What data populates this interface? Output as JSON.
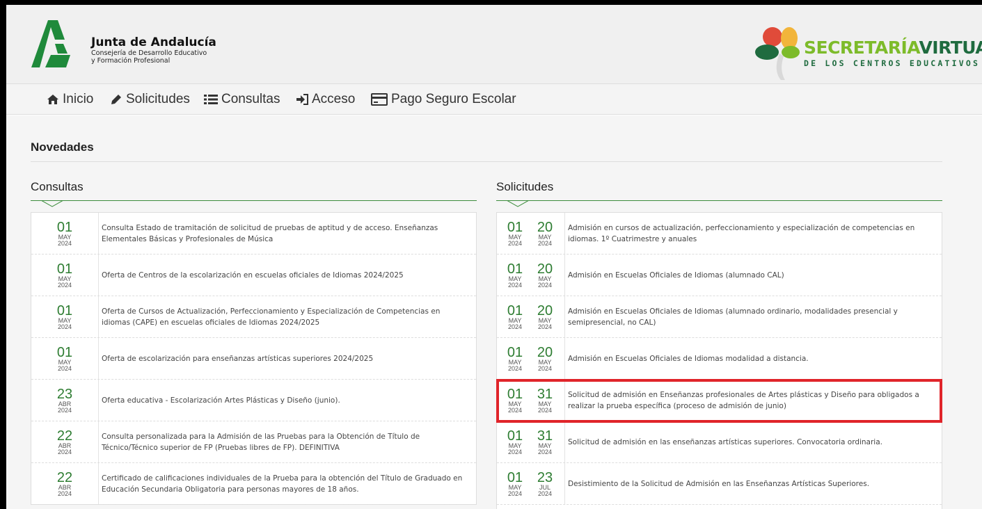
{
  "header": {
    "org_title": "Junta de Andalucía",
    "org_sub1": "Consejería de Desarrollo Educativo",
    "org_sub2": "y Formación Profesional",
    "sv_title_a": "SECRETARÍA",
    "sv_title_b": "VIRTUAL",
    "sv_sub": "DE LOS CENTROS EDUCATIVOS"
  },
  "nav": [
    {
      "label": "Inicio",
      "icon": "home-icon"
    },
    {
      "label": "Solicitudes",
      "icon": "pencil-icon"
    },
    {
      "label": "Consultas",
      "icon": "list-icon"
    },
    {
      "label": "Acceso",
      "icon": "sign-in-icon"
    },
    {
      "label": "Pago Seguro Escolar",
      "icon": "credit-card-icon"
    }
  ],
  "novedades_title": "Novedades",
  "consultas": {
    "title": "Consultas",
    "rows": [
      {
        "day": "01",
        "mon": "MAY",
        "yr": "2024",
        "text": "Consulta Estado de tramitación de solicitud de pruebas de aptitud y de acceso. Enseñanzas Elementales Básicas y Profesionales de Música"
      },
      {
        "day": "01",
        "mon": "MAY",
        "yr": "2024",
        "text": "Oferta de Centros de la escolarización en escuelas oficiales de Idiomas 2024/2025"
      },
      {
        "day": "01",
        "mon": "MAY",
        "yr": "2024",
        "text": "Oferta de Cursos de Actualización, Perfeccionamiento y Especialización de Competencias en idiomas (CAPE) en escuelas oficiales de Idiomas 2024/2025"
      },
      {
        "day": "01",
        "mon": "MAY",
        "yr": "2024",
        "text": "Oferta de escolarización para enseñanzas artísticas superiores 2024/2025"
      },
      {
        "day": "23",
        "mon": "ABR",
        "yr": "2024",
        "text": "Oferta educativa - Escolarización Artes Plásticas y Diseño (junio)."
      },
      {
        "day": "22",
        "mon": "ABR",
        "yr": "2024",
        "text": "Consulta personalizada para la Admisión de las Pruebas para la Obtención de Título de Técnico/Técnico superior de FP (Pruebas libres de FP). DEFINITIVA"
      },
      {
        "day": "22",
        "mon": "ABR",
        "yr": "2024",
        "text": "Certificado de calificaciones individuales de la Prueba para la obtención del Título de Graduado en Educación Secundaria Obligatoria para personas mayores de 18 años."
      }
    ]
  },
  "solicitudes": {
    "title": "Solicitudes",
    "rows": [
      {
        "d1": "01",
        "m1": "MAY",
        "y1": "2024",
        "d2": "20",
        "m2": "MAY",
        "y2": "2024",
        "text": "Admisión en cursos de actualización, perfeccionamiento y especialización de competencias en idiomas. 1º Cuatrimestre y anuales"
      },
      {
        "d1": "01",
        "m1": "MAY",
        "y1": "2024",
        "d2": "20",
        "m2": "MAY",
        "y2": "2024",
        "text": "Admisión en Escuelas Oficiales de Idiomas (alumnado CAL)"
      },
      {
        "d1": "01",
        "m1": "MAY",
        "y1": "2024",
        "d2": "20",
        "m2": "MAY",
        "y2": "2024",
        "text": "Admisión en Escuelas Oficiales de Idiomas (alumnado ordinario, modalidades presencial y semipresencial, no CAL)"
      },
      {
        "d1": "01",
        "m1": "MAY",
        "y1": "2024",
        "d2": "20",
        "m2": "MAY",
        "y2": "2024",
        "text": "Admisión en Escuelas Oficiales de Idiomas modalidad a distancia."
      },
      {
        "d1": "01",
        "m1": "MAY",
        "y1": "2024",
        "d2": "31",
        "m2": "MAY",
        "y2": "2024",
        "text": "Solicitud de admisión en Enseñanzas profesionales de Artes plásticas y Diseño para obligados a realizar la prueba específica (proceso de admisión de junio)"
      },
      {
        "d1": "01",
        "m1": "MAY",
        "y1": "2024",
        "d2": "31",
        "m2": "MAY",
        "y2": "2024",
        "text": "Solicitud de admisión en las enseñanzas artísticas superiores. Convocatoria ordinaria."
      },
      {
        "d1": "01",
        "m1": "MAY",
        "y1": "2024",
        "d2": "23",
        "m2": "JUL",
        "y2": "2024",
        "text": "Desistimiento de la Solicitud de Admisión en las Enseñanzas Artísticas Superiores."
      }
    ]
  },
  "colors": {
    "accent_green": "#2e7d32",
    "highlight_red": "#e0242a"
  }
}
